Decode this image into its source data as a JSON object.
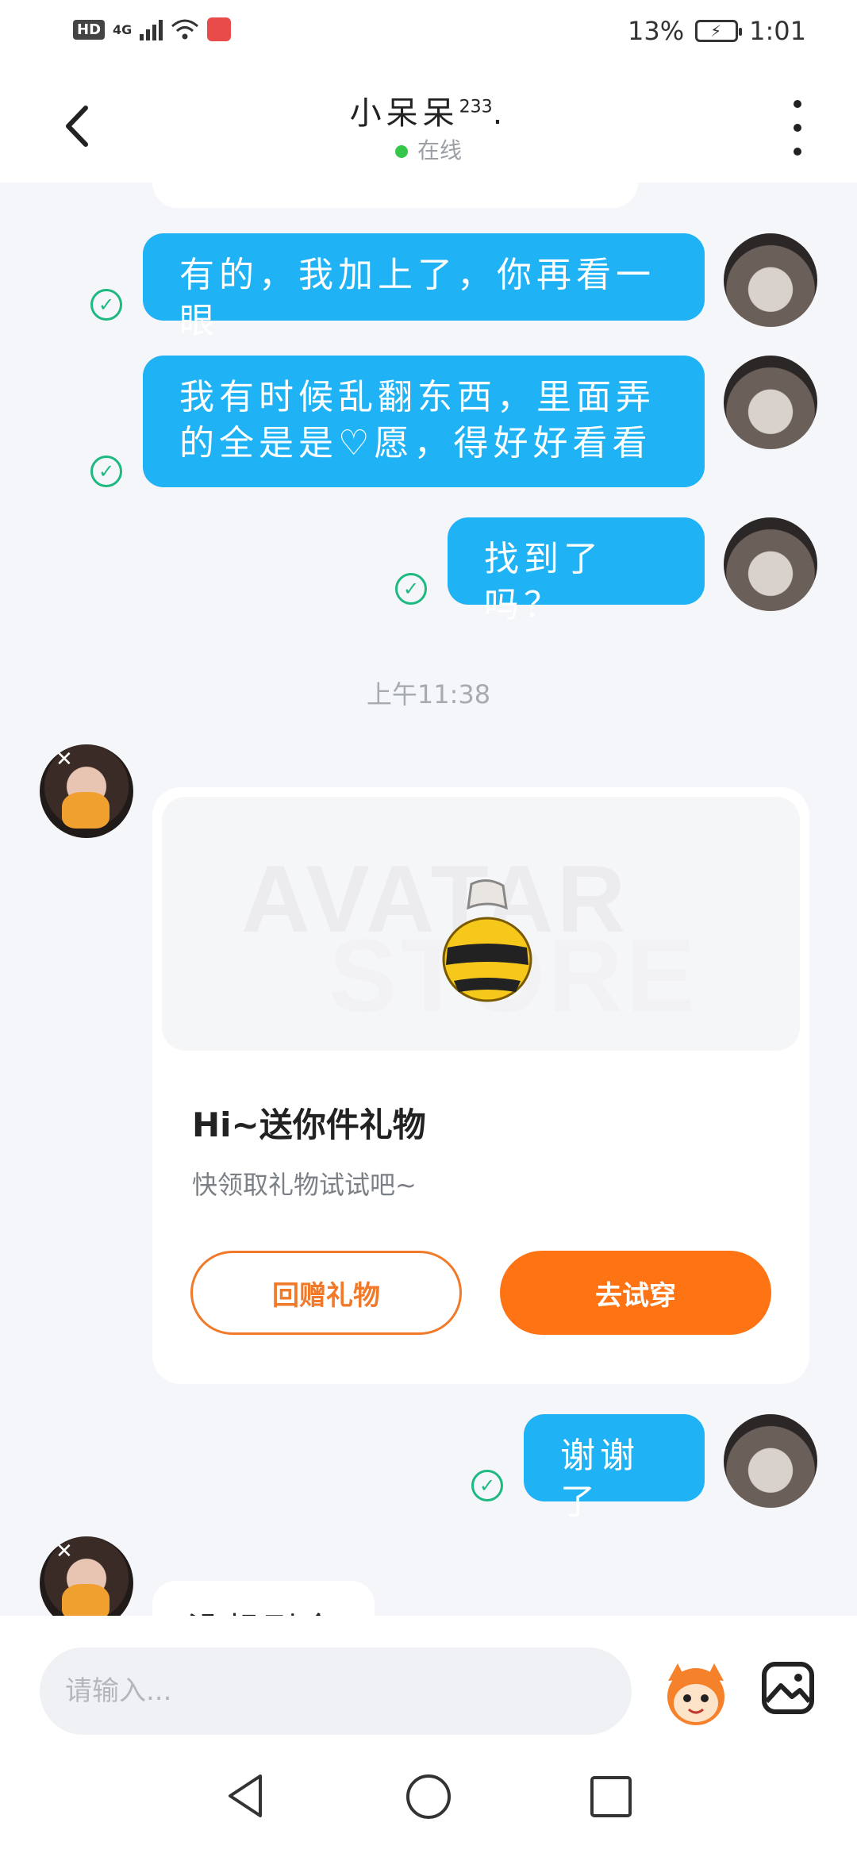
{
  "status_bar": {
    "hd": "HD",
    "network": "4G",
    "app_badge": "HUAWEI",
    "battery": "13%",
    "time": "1:01"
  },
  "header": {
    "title": "小呆呆",
    "title_sup": "233",
    "title_suffix": ".",
    "presence": "在线",
    "presence_color": "#35c74a"
  },
  "messages": [
    {
      "from": "me",
      "text": "有的，我加上了，你再看一眼",
      "status": "read"
    },
    {
      "from": "me",
      "text": "我有时候乱翻东西，里面弄的全是是♡愿，得好好看看",
      "status": "read"
    },
    {
      "from": "me",
      "text": "找到了吗？",
      "status": "read"
    },
    {
      "from": "me",
      "text": "谢谢了",
      "status": "read"
    },
    {
      "from": "other",
      "text": "没想到今",
      "status": ""
    }
  ],
  "timestamp": "上午11:38",
  "gift_card": {
    "watermark_line1": "AVATAR",
    "watermark_line2": "STORE",
    "item_icon": "bee-gift-icon",
    "title": "Hi~送你件礼物",
    "subtitle": "快领取礼物试试吧~",
    "return_button": "回赠礼物",
    "try_button": "去试穿"
  },
  "input": {
    "placeholder": "请输入..."
  },
  "colors": {
    "outgoing_bubble": "#1fb2f4",
    "read_check": "#1eb980",
    "accent_orange": "#fe7415"
  }
}
